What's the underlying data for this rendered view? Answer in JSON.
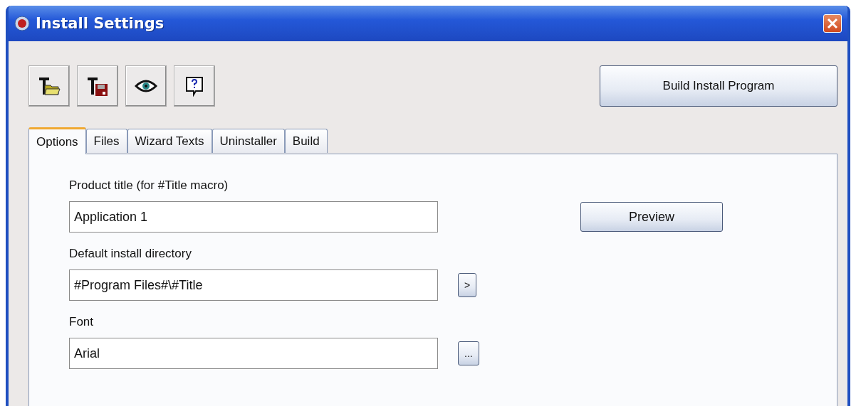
{
  "window": {
    "title": "Install Settings"
  },
  "toolbar": [
    {
      "kind": "open"
    },
    {
      "kind": "save"
    },
    {
      "kind": "view"
    },
    {
      "kind": "help"
    }
  ],
  "build_button": {
    "label": "Build Install Program"
  },
  "tabs": [
    {
      "label": "Options",
      "selected": true
    },
    {
      "label": "Files",
      "selected": false
    },
    {
      "label": "Wizard Texts",
      "selected": false
    },
    {
      "label": "Uninstaller",
      "selected": false
    },
    {
      "label": "Build",
      "selected": false
    }
  ],
  "fields": [
    {
      "label": "Product title (for #Title macro)",
      "value": "Application 1",
      "side": {
        "kind": "wide",
        "label": "Preview"
      }
    },
    {
      "label": "Default install directory",
      "value": "#Program Files#\\#Title",
      "side": {
        "kind": "small",
        "label": ">"
      }
    },
    {
      "label": "Font",
      "value": "Arial",
      "side": {
        "kind": "small",
        "label": "..."
      }
    }
  ]
}
